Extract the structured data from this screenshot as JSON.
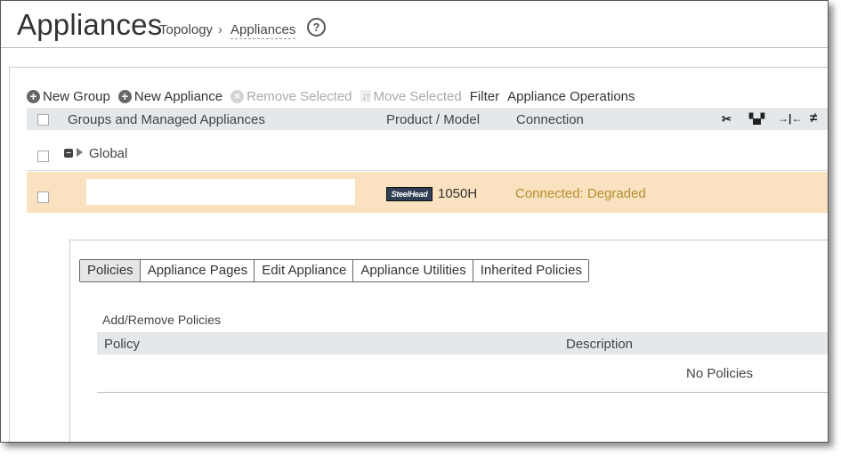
{
  "header": {
    "title": "Appliances",
    "breadcrumb": {
      "parent": "Topology",
      "separator": "›",
      "current": "Appliances"
    },
    "help_icon": "?"
  },
  "toolbar": {
    "new_group": "New Group",
    "new_appliance": "New Appliance",
    "remove_selected": "Remove Selected",
    "move_selected": "Move Selected",
    "filter": "Filter",
    "appliance_operations": "Appliance Operations"
  },
  "table": {
    "columns": {
      "groups": "Groups and Managed Appliances",
      "product": "Product / Model",
      "connection": "Connection"
    },
    "header_icons": [
      "scissors-icon",
      "network-icon",
      "arrow-bar-icon",
      "not-equal-icon"
    ]
  },
  "global_row": {
    "label": "Global"
  },
  "appliance_row": {
    "name": "",
    "product_logo": "SteelHead",
    "model": "1050H",
    "connection": "Connected: Degraded",
    "connection_color": "#b58f2e",
    "row_color": "#fae1c0"
  },
  "detail": {
    "tabs": [
      "Policies",
      "Appliance Pages",
      "Edit Appliance",
      "Appliance Utilities",
      "Inherited Policies"
    ],
    "active_tab": "Policies",
    "add_remove": "Add/Remove Policies",
    "policy_columns": {
      "policy": "Policy",
      "description": "Description"
    },
    "empty_text": "No Policies"
  }
}
